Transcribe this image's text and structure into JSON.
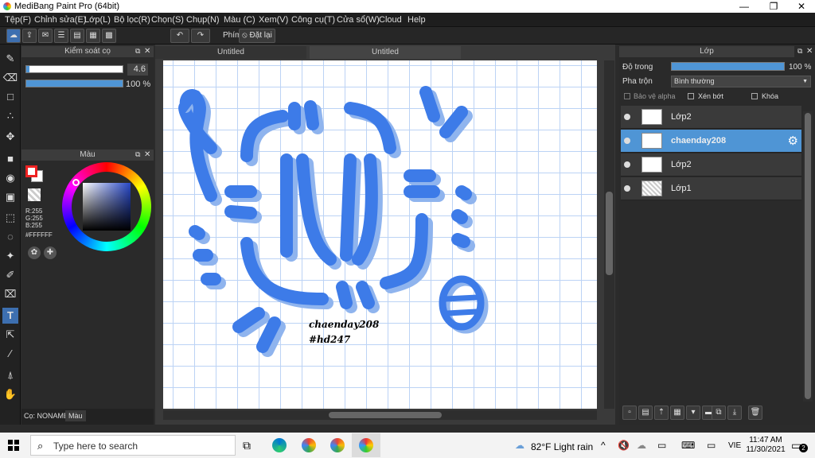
{
  "window": {
    "title": "MediBang Paint Pro (64bit)",
    "controls": [
      "—",
      "❐",
      "✕"
    ]
  },
  "menu": [
    "Tệp(F)",
    "Chỉnh sửa(E)",
    "Lớp(L)",
    "Bộ lọc(R)",
    "Chọn(S)",
    "Chụp(N)",
    "Màu (C)",
    "Xem(V)",
    "Công cụ(T)",
    "Cửa sổ(W)",
    "Cloud",
    "Help"
  ],
  "toolbar": {
    "phim_label": "Phím",
    "reset_label": "Đặt lại"
  },
  "brush_panel": {
    "title": "Kiểm soát cọ",
    "size_value": "4.6",
    "opacity_value": "100 %",
    "size_fraction": 0.03,
    "opacity_fraction": 1.0
  },
  "color_panel": {
    "title": "Màu",
    "r": "R:255",
    "g": "G:255",
    "b": "B:255",
    "hex": "#FFFFFF"
  },
  "left_bottom": {
    "brush_name": "Cọ: NONAME",
    "tab": "Màu"
  },
  "tabs": [
    "Untitled",
    "Untitled"
  ],
  "layer_panel": {
    "title": "Lớp",
    "opacity_label": "Độ trong",
    "opacity_value": "100 %",
    "blend_label": "Pha trộn",
    "blend_value": "Bình thường",
    "protect_alpha": "Bảo vệ alpha",
    "clip": "Xén bớt",
    "lock": "Khóa"
  },
  "layers": [
    {
      "name": "Lớp2",
      "selected": false
    },
    {
      "name": "chaenday208",
      "selected": true
    },
    {
      "name": "Lớp2",
      "selected": false
    },
    {
      "name": "Lớp1",
      "selected": false
    }
  ],
  "canvas_text": [
    "chaenday208",
    "#hd247"
  ],
  "taskbar": {
    "search_placeholder": "Type here to search",
    "weather": "82°F  Light rain",
    "lang": "VIE",
    "time": "11:47 AM",
    "date": "11/30/2021",
    "notif_count": "2"
  },
  "colors": {
    "accent": "#3d7be8",
    "selected_layer": "#4f95d5"
  }
}
